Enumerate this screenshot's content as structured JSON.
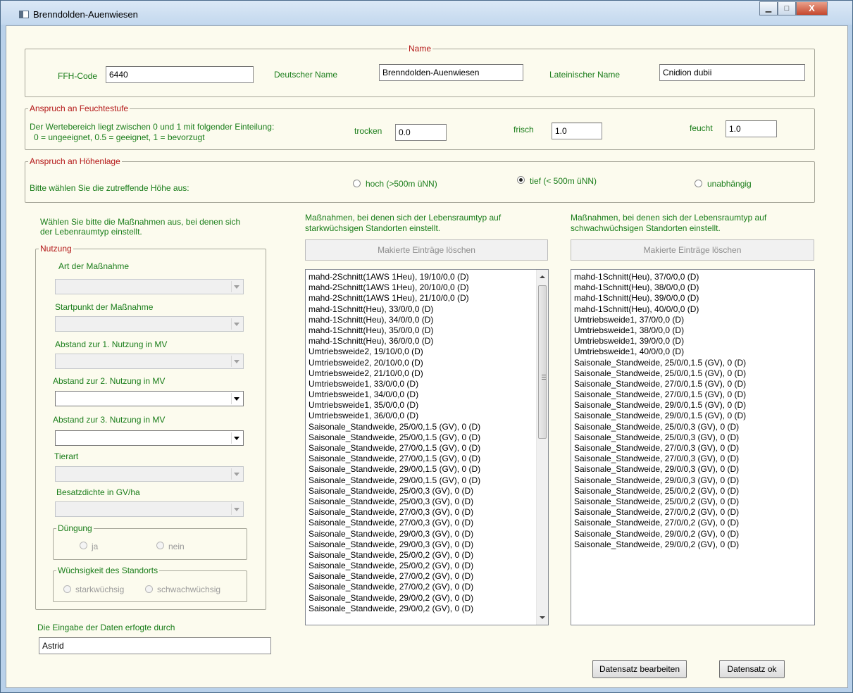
{
  "window": {
    "title": "Brenndolden-Auenwiesen",
    "minimize": "▁",
    "maximize": "□",
    "close": "X"
  },
  "name_group": {
    "legend": "Name",
    "ffh_label": "FFH-Code",
    "ffh_value": "6440",
    "de_label": "Deutscher Name",
    "de_value": "Brenndolden-Auenwiesen",
    "lat_label": "Lateinischer Name",
    "lat_value": "Cnidion dubii"
  },
  "feuchte_group": {
    "legend": "Anspruch an Feuchtestufe",
    "desc1": "Der Wertebereich liegt zwischen 0 und 1 mit folgender Einteilung:",
    "desc2": "0 = ungeeignet,  0.5 = geeignet,  1 = bevorzugt",
    "trocken_label": "trocken",
    "trocken_value": "0.0",
    "frisch_label": "frisch",
    "frisch_value": "1.0",
    "feucht_label": "feucht",
    "feucht_value": "1.0"
  },
  "hoehe_group": {
    "legend": "Anspruch an Höhenlage",
    "prompt": "Bitte wählen Sie die zutreffende Höhe aus:",
    "opt_hoch": "hoch (>500m üNN)",
    "opt_tief": "tief (< 500m üNN)",
    "opt_unab": "unabhängig",
    "selected": "tief"
  },
  "massnahmen_intro": {
    "line1": "Wählen Sie bitte die Maßnahmen aus, bei denen sich",
    "line2": "der Lebenraumtyp einstellt."
  },
  "nutzung": {
    "legend": "Nutzung",
    "art_label": "Art der Maßnahme",
    "start_label": "Startpunkt der Maßnahme",
    "abst1_label": "Abstand zur 1. Nutzung in MV",
    "abst2_label": "Abstand zur 2. Nutzung in MV",
    "abst3_label": "Abstand zur 3. Nutzung in MV",
    "tierart_label": "Tierart",
    "besatz_label": "Besatzdichte in GV/ha",
    "duengung_legend": "Düngung",
    "duengung_ja": "ja",
    "duengung_nein": "nein",
    "wuchs_legend": "Wüchsigkeit des Standorts",
    "wuchs_stark": "starkwüchsig",
    "wuchs_schwach": "schwachwüchsig"
  },
  "eingabe": {
    "label": "Die Eingabe der Daten erfogte durch",
    "value": "Astrid"
  },
  "stark": {
    "line1": "Maßnahmen, bei denen sich der Lebensraumtyp auf",
    "line2": "starkwüchsigen Standorten einstellt.",
    "delete_button": "Makierte Einträge löschen",
    "items": [
      "mahd-2Schnitt(1AWS 1Heu), 19/10/0,0 (D)",
      "mahd-2Schnitt(1AWS 1Heu), 20/10/0,0 (D)",
      "mahd-2Schnitt(1AWS 1Heu), 21/10/0,0 (D)",
      "mahd-1Schnitt(Heu), 33/0/0,0 (D)",
      "mahd-1Schnitt(Heu), 34/0/0,0 (D)",
      "mahd-1Schnitt(Heu), 35/0/0,0 (D)",
      "mahd-1Schnitt(Heu), 36/0/0,0 (D)",
      "Umtriebsweide2, 19/10/0,0 (D)",
      "Umtriebsweide2, 20/10/0,0 (D)",
      "Umtriebsweide2, 21/10/0,0 (D)",
      "Umtriebsweide1, 33/0/0,0 (D)",
      "Umtriebsweide1, 34/0/0,0 (D)",
      "Umtriebsweide1, 35/0/0,0 (D)",
      "Umtriebsweide1, 36/0/0,0 (D)",
      "Saisonale_Standweide, 25/0/0,1.5 (GV), 0 (D)",
      "Saisonale_Standweide, 25/0/0,1.5 (GV), 0 (D)",
      "Saisonale_Standweide, 27/0/0,1.5 (GV), 0 (D)",
      "Saisonale_Standweide, 27/0/0,1.5 (GV), 0 (D)",
      "Saisonale_Standweide, 29/0/0,1.5 (GV), 0 (D)",
      "Saisonale_Standweide, 29/0/0,1.5 (GV), 0 (D)",
      "Saisonale_Standweide, 25/0/0,3 (GV), 0 (D)",
      "Saisonale_Standweide, 25/0/0,3 (GV), 0 (D)",
      "Saisonale_Standweide, 27/0/0,3 (GV), 0 (D)",
      "Saisonale_Standweide, 27/0/0,3 (GV), 0 (D)",
      "Saisonale_Standweide, 29/0/0,3 (GV), 0 (D)",
      "Saisonale_Standweide, 29/0/0,3 (GV), 0 (D)",
      "Saisonale_Standweide, 25/0/0,2 (GV), 0 (D)",
      "Saisonale_Standweide, 25/0/0,2 (GV), 0 (D)",
      "Saisonale_Standweide, 27/0/0,2 (GV), 0 (D)",
      "Saisonale_Standweide, 27/0/0,2 (GV), 0 (D)",
      "Saisonale_Standweide, 29/0/0,2 (GV), 0 (D)",
      "Saisonale_Standweide, 29/0/0,2 (GV), 0 (D)"
    ]
  },
  "schwach": {
    "line1": "Maßnahmen, bei denen sich der Lebensraumtyp auf",
    "line2": "schwachwüchsigen Standorten einstellt.",
    "delete_button": "Makierte Einträge löschen",
    "items": [
      "mahd-1Schnitt(Heu), 37/0/0,0 (D)",
      "mahd-1Schnitt(Heu), 38/0/0,0 (D)",
      "mahd-1Schnitt(Heu), 39/0/0,0 (D)",
      "mahd-1Schnitt(Heu), 40/0/0,0 (D)",
      "Umtriebsweide1, 37/0/0,0 (D)",
      "Umtriebsweide1, 38/0/0,0 (D)",
      "Umtriebsweide1, 39/0/0,0 (D)",
      "Umtriebsweide1, 40/0/0,0 (D)",
      "Saisonale_Standweide, 25/0/0,1.5 (GV), 0 (D)",
      "Saisonale_Standweide, 25/0/0,1.5 (GV), 0 (D)",
      "Saisonale_Standweide, 27/0/0,1.5 (GV), 0 (D)",
      "Saisonale_Standweide, 27/0/0,1.5 (GV), 0 (D)",
      "Saisonale_Standweide, 29/0/0,1.5 (GV), 0 (D)",
      "Saisonale_Standweide, 29/0/0,1.5 (GV), 0 (D)",
      "Saisonale_Standweide, 25/0/0,3 (GV), 0 (D)",
      "Saisonale_Standweide, 25/0/0,3 (GV), 0 (D)",
      "Saisonale_Standweide, 27/0/0,3 (GV), 0 (D)",
      "Saisonale_Standweide, 27/0/0,3 (GV), 0 (D)",
      "Saisonale_Standweide, 29/0/0,3 (GV), 0 (D)",
      "Saisonale_Standweide, 29/0/0,3 (GV), 0 (D)",
      "Saisonale_Standweide, 25/0/0,2 (GV), 0 (D)",
      "Saisonale_Standweide, 25/0/0,2 (GV), 0 (D)",
      "Saisonale_Standweide, 27/0/0,2 (GV), 0 (D)",
      "Saisonale_Standweide, 27/0/0,2 (GV), 0 (D)",
      "Saisonale_Standweide, 29/0/0,2 (GV), 0 (D)",
      "Saisonale_Standweide, 29/0/0,2 (GV), 0 (D)"
    ]
  },
  "footer": {
    "edit_button": "Datensatz bearbeiten",
    "ok_button": "Datensatz ok"
  },
  "colors": {
    "legend_red": "#b31616",
    "label_green": "#1a7d1a",
    "client_bg": "#fcfbee",
    "window_frame": "#b9d1ea"
  }
}
